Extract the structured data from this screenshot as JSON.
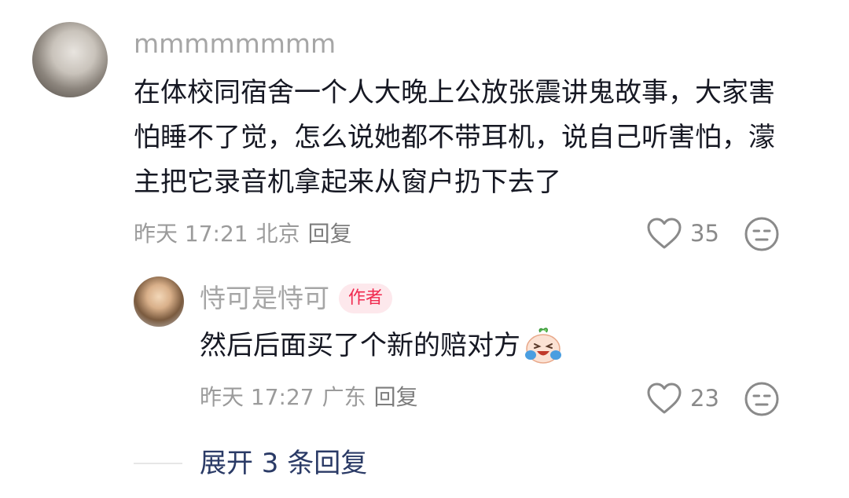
{
  "comment": {
    "username": "mmmmmmmm",
    "text": "在体校同宿舍一个人大晚上公放张震讲鬼故事，大家害怕睡不了觉，怎么说她都不带耳机，说自己听害怕，濛主把它录音机拿起来从窗户扔下去了",
    "time": "昨天 17:21",
    "location": "北京",
    "reply_label": "回复",
    "likes": "35",
    "avatar_icon": "user-avatar-photo"
  },
  "reply": {
    "username": "恃可是恃可",
    "badge": "作者",
    "text": "然后后面买了个新的赔对方",
    "emoji_icon": "crying-laughing-radish-emoji",
    "time": "昨天 17:27",
    "location": "广东",
    "reply_label": "回复",
    "likes": "23",
    "avatar_icon": "user-avatar-photo"
  },
  "expand": {
    "label": "展开 3 条回复"
  },
  "colors": {
    "author_badge_text": "#f02a4f",
    "author_badge_bg": "#fde8ec",
    "expand_link": "#2a3a66"
  }
}
